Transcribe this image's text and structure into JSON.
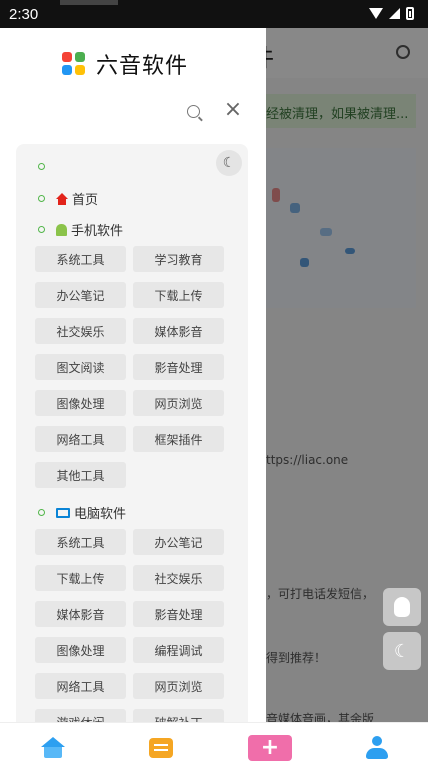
{
  "status_bar": {
    "time": "2:30"
  },
  "site": {
    "name": "六音软件"
  },
  "background": {
    "title": "件",
    "notice": "经被清理，如果被清理...",
    "texts": [
      "ttps://liac.one",
      "，可打电话发短信，",
      "得到推荐！",
      "音媒体音画，其余版"
    ]
  },
  "menu": {
    "home_label": "首页",
    "mobile": {
      "label": "手机软件",
      "items": [
        "系统工具",
        "学习教育",
        "办公笔记",
        "下载上传",
        "社交娱乐",
        "媒体影音",
        "图文阅读",
        "影音处理",
        "图像处理",
        "网页浏览",
        "网络工具",
        "框架插件",
        "其他工具"
      ]
    },
    "pc": {
      "label": "电脑软件",
      "items": [
        "系统工具",
        "办公笔记",
        "下载上传",
        "社交娱乐",
        "媒体影音",
        "影音处理",
        "图像处理",
        "编程调试",
        "网络工具",
        "网页浏览",
        "游戏休闲",
        "破解补丁"
      ]
    }
  },
  "icons": {
    "search": "search-icon",
    "close": "close-icon",
    "theme": "moon-icon",
    "qq": "qq-icon"
  },
  "colors": {
    "accent_green": "#52b64a",
    "home_red": "#e2231a",
    "android_green": "#8bc34a",
    "pc_blue": "#0a84d6",
    "add_pink": "#f06eaa"
  }
}
